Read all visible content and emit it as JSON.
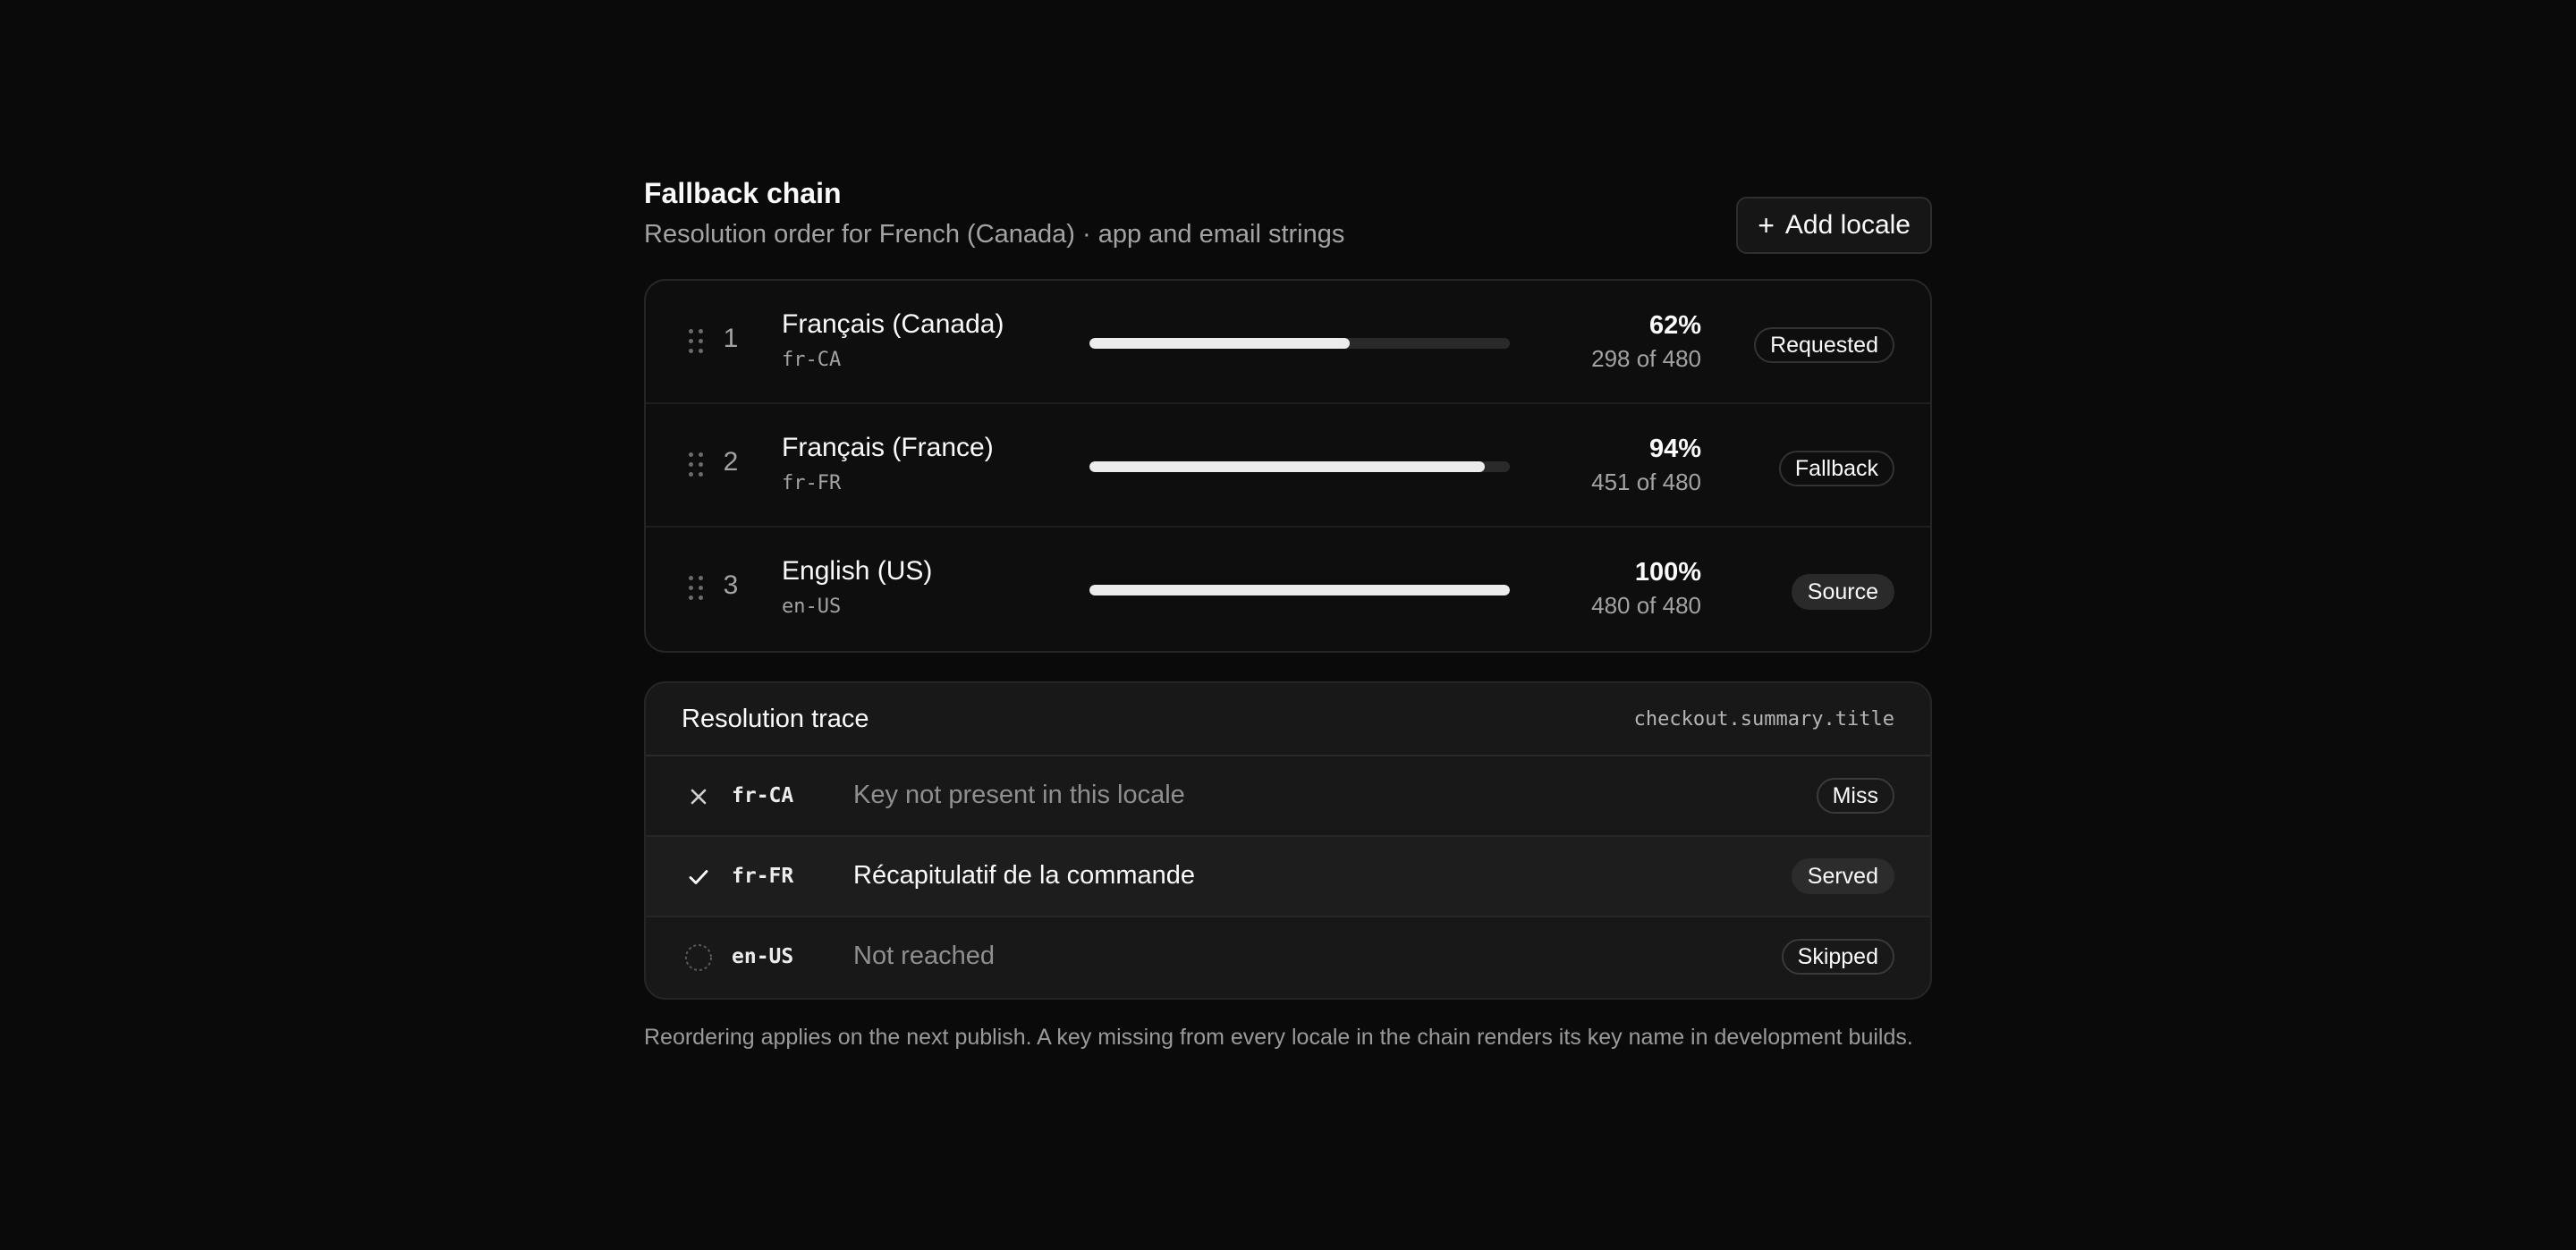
{
  "header": {
    "title": "Fallback chain",
    "subtitle": "Resolution order for French (Canada) · app and email strings",
    "add_button_icon": "plus-icon",
    "add_button_label": "Add locale"
  },
  "chain": [
    {
      "rank": "1",
      "name": "Français (Canada)",
      "code": "fr-CA",
      "progress": 0.62,
      "percent": "62%",
      "count": "298 of 480",
      "badge": "Requested",
      "badge_style": "outline"
    },
    {
      "rank": "2",
      "name": "Français (France)",
      "code": "fr-FR",
      "progress": 0.94,
      "percent": "94%",
      "count": "451 of 480",
      "badge": "Fallback",
      "badge_style": "outline"
    },
    {
      "rank": "3",
      "name": "English (US)",
      "code": "en-US",
      "progress": 1.0,
      "percent": "100%",
      "count": "480 of 480",
      "badge": "Source",
      "badge_style": "solid"
    }
  ],
  "trace": {
    "title": "Resolution trace",
    "key": "checkout.summary.title",
    "rows": [
      {
        "icon": "x-icon",
        "code": "fr-CA",
        "message": "Key not present in this locale",
        "badge": "Miss",
        "state": "miss"
      },
      {
        "icon": "check-icon",
        "code": "fr-FR",
        "message": "Récapitulatif de la commande",
        "badge": "Served",
        "state": "served"
      },
      {
        "icon": "dashed-circle-icon",
        "code": "en-US",
        "message": "Not reached",
        "badge": "Skipped",
        "state": "skipped"
      }
    ]
  },
  "footnote": "Reordering applies on the next publish. A key missing from every locale in the chain renders its key name in development builds."
}
